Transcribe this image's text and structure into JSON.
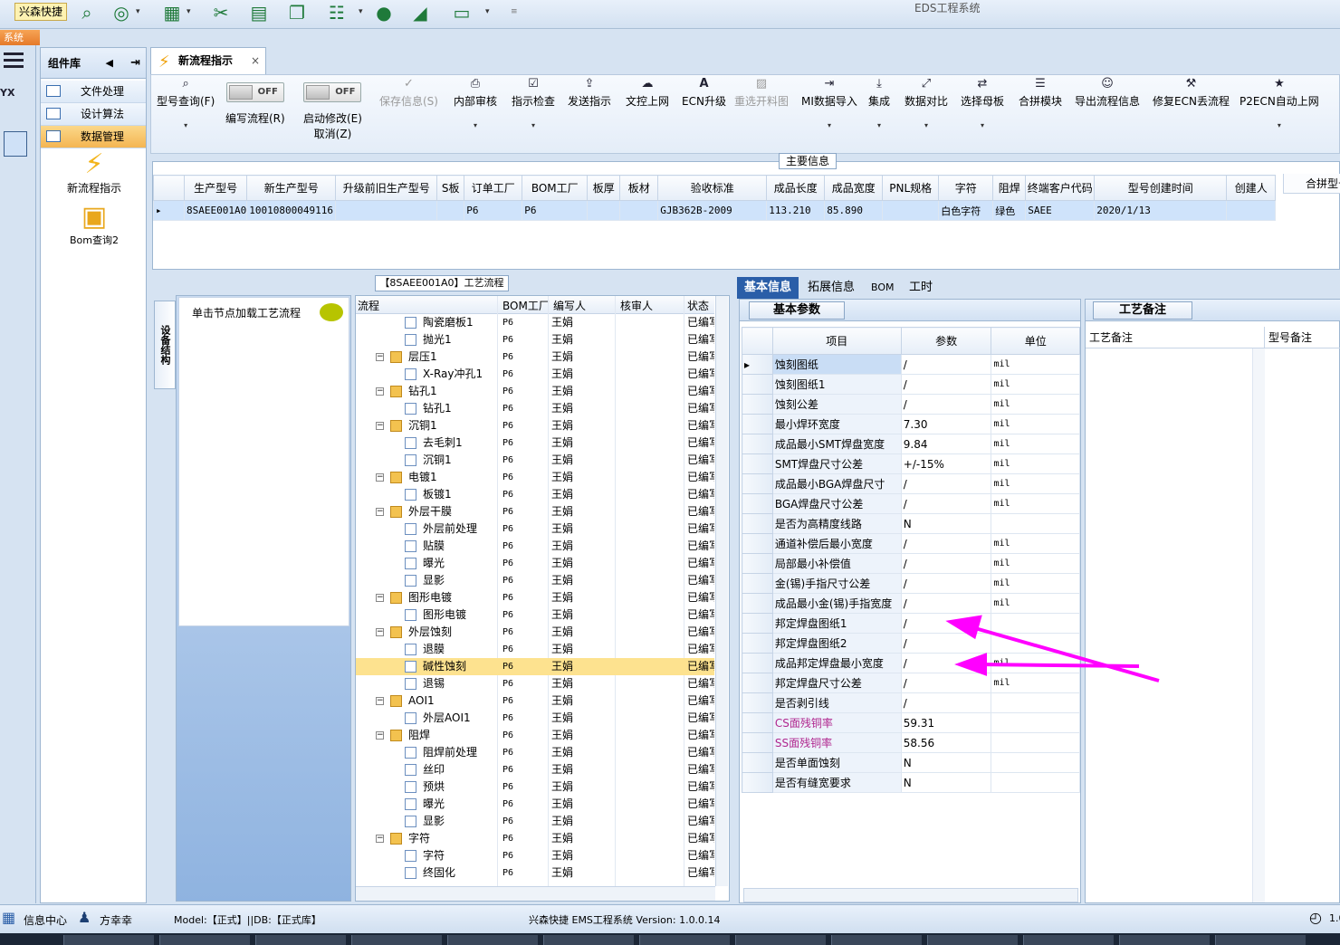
{
  "topbar": {
    "badge": "兴森快捷",
    "window_title": "EDS工程系统"
  },
  "systab": "系统",
  "component_panel": {
    "title": "组件库",
    "items": [
      "文件处理",
      "设计算法",
      "数据管理"
    ],
    "active_index": 2,
    "icons": [
      {
        "label": "新流程指示",
        "icon": "lightning-icon"
      },
      {
        "label": "Bom查询2",
        "icon": "folder-open-icon"
      }
    ]
  },
  "doc_tab": {
    "label": "新流程指示"
  },
  "toolbar": {
    "buttons": [
      {
        "label": "型号查询(F)",
        "icon": "search-icon",
        "enabled": true,
        "dropdown": true
      },
      {
        "label": "编写流程(R)",
        "toggle": "OFF"
      },
      {
        "label": "启动修改(E)",
        "label2": "取消(Z)",
        "toggle": "OFF"
      },
      {
        "label": "保存信息(S)",
        "icon": "check-icon",
        "enabled": false
      },
      {
        "label": "内部审核",
        "icon": "printer-icon",
        "enabled": true,
        "dropdown": true
      },
      {
        "label": "指示检查",
        "icon": "checkbox-icon",
        "enabled": true,
        "dropdown": true
      },
      {
        "label": "发送指示",
        "icon": "upload-icon",
        "enabled": true
      },
      {
        "label": "文控上网",
        "icon": "cloud-upload-icon",
        "enabled": true
      },
      {
        "label": "ECN升级",
        "icon": "font-icon",
        "enabled": true
      },
      {
        "label": "重选开料图",
        "icon": "image-icon",
        "enabled": false
      },
      {
        "label": "MI数据导入",
        "icon": "import-icon",
        "enabled": true,
        "dropdown": true
      },
      {
        "label": "集成",
        "icon": "download-icon",
        "enabled": true,
        "dropdown": true
      },
      {
        "label": "数据对比",
        "icon": "compare-icon",
        "enabled": true,
        "dropdown": true
      },
      {
        "label": "选择母板",
        "icon": "shuffle-icon",
        "enabled": true,
        "dropdown": true
      },
      {
        "label": "合拼模块",
        "icon": "list-icon",
        "enabled": true
      },
      {
        "label": "导出流程信息",
        "icon": "smile-icon",
        "enabled": true
      },
      {
        "label": "修复ECN丢流程",
        "icon": "wrench-icon",
        "enabled": true
      },
      {
        "label": "P2ECN自动上网",
        "icon": "star-icon",
        "enabled": true,
        "dropdown": true
      }
    ]
  },
  "main_info": {
    "title": "主要信息",
    "columns": [
      "生产型号",
      "新生产型号",
      "升级前旧生产型号",
      "S板",
      "订单工厂",
      "BOM工厂",
      "板厚",
      "板材",
      "验收标准",
      "成品长度",
      "成品宽度",
      "PNL规格",
      "字符",
      "阻焊",
      "终端客户代码",
      "型号创建时间",
      "创建人"
    ],
    "rows": [
      [
        "8SAEE001A0",
        "10010800049116",
        "",
        "",
        "P6",
        "P6",
        "",
        "",
        "GJB362B-2009",
        "113.210",
        "85.890",
        "",
        "白色字符",
        "绿色",
        "SAEE",
        "2020/1/13",
        ""
      ]
    ],
    "side_column": "合拼型号"
  },
  "process": {
    "title": "【8SAEE001A0】工艺流程",
    "equip_tab": "设备结构",
    "load_hint": "单击节点加载工艺流程",
    "columns": [
      "流程",
      "BOM工厂",
      "编写人",
      "核审人",
      "状态"
    ],
    "rows": [
      {
        "name": "陶瓷磨板1",
        "level": 2,
        "bom": "P6",
        "author": "王娟",
        "status": "已编写"
      },
      {
        "name": "抛光1",
        "level": 2,
        "bom": "P6",
        "author": "王娟",
        "status": "已编写"
      },
      {
        "name": "层压1",
        "level": 1,
        "bom": "P6",
        "author": "王娟",
        "status": "已编写"
      },
      {
        "name": "X-Ray冲孔1",
        "level": 2,
        "bom": "P6",
        "author": "王娟",
        "status": "已编写"
      },
      {
        "name": "钻孔1",
        "level": 1,
        "bom": "P6",
        "author": "王娟",
        "status": "已编写"
      },
      {
        "name": "钻孔1",
        "level": 2,
        "bom": "P6",
        "author": "王娟",
        "status": "已编写"
      },
      {
        "name": "沉铜1",
        "level": 1,
        "bom": "P6",
        "author": "王娟",
        "status": "已编写"
      },
      {
        "name": "去毛刺1",
        "level": 2,
        "bom": "P6",
        "author": "王娟",
        "status": "已编写"
      },
      {
        "name": "沉铜1",
        "level": 2,
        "bom": "P6",
        "author": "王娟",
        "status": "已编写"
      },
      {
        "name": "电镀1",
        "level": 1,
        "bom": "P6",
        "author": "王娟",
        "status": "已编写"
      },
      {
        "name": "板镀1",
        "level": 2,
        "bom": "P6",
        "author": "王娟",
        "status": "已编写"
      },
      {
        "name": "外层干膜",
        "level": 1,
        "bom": "P6",
        "author": "王娟",
        "status": "已编写"
      },
      {
        "name": "外层前处理",
        "level": 2,
        "bom": "P6",
        "author": "王娟",
        "status": "已编写"
      },
      {
        "name": "贴膜",
        "level": 2,
        "bom": "P6",
        "author": "王娟",
        "status": "已编写"
      },
      {
        "name": "曝光",
        "level": 2,
        "bom": "P6",
        "author": "王娟",
        "status": "已编写"
      },
      {
        "name": "显影",
        "level": 2,
        "bom": "P6",
        "author": "王娟",
        "status": "已编写"
      },
      {
        "name": "图形电镀",
        "level": 1,
        "bom": "P6",
        "author": "王娟",
        "status": "已编写"
      },
      {
        "name": "图形电镀",
        "level": 2,
        "bom": "P6",
        "author": "王娟",
        "status": "已编写"
      },
      {
        "name": "外层蚀刻",
        "level": 1,
        "bom": "P6",
        "author": "王娟",
        "status": "已编写"
      },
      {
        "name": "退膜",
        "level": 2,
        "bom": "P6",
        "author": "王娟",
        "status": "已编写"
      },
      {
        "name": "碱性蚀刻",
        "level": 2,
        "bom": "P6",
        "author": "王娟",
        "status": "已编写",
        "selected": true
      },
      {
        "name": "退锡",
        "level": 2,
        "bom": "P6",
        "author": "王娟",
        "status": "已编写"
      },
      {
        "name": "AOI1",
        "level": 1,
        "bom": "P6",
        "author": "王娟",
        "status": "已编写"
      },
      {
        "name": "外层AOI1",
        "level": 2,
        "bom": "P6",
        "author": "王娟",
        "status": "已编写"
      },
      {
        "name": "阻焊",
        "level": 1,
        "bom": "P6",
        "author": "王娟",
        "status": "已编写"
      },
      {
        "name": "阻焊前处理",
        "level": 2,
        "bom": "P6",
        "author": "王娟",
        "status": "已编写"
      },
      {
        "name": "丝印",
        "level": 2,
        "bom": "P6",
        "author": "王娟",
        "status": "已编写"
      },
      {
        "name": "预烘",
        "level": 2,
        "bom": "P6",
        "author": "王娟",
        "status": "已编写"
      },
      {
        "name": "曝光",
        "level": 2,
        "bom": "P6",
        "author": "王娟",
        "status": "已编写"
      },
      {
        "name": "显影",
        "level": 2,
        "bom": "P6",
        "author": "王娟",
        "status": "已编写"
      },
      {
        "name": "字符",
        "level": 1,
        "bom": "P6",
        "author": "王娟",
        "status": "已编写"
      },
      {
        "name": "字符",
        "level": 2,
        "bom": "P6",
        "author": "王娟",
        "status": "已编写"
      },
      {
        "name": "终固化",
        "level": 2,
        "bom": "P6",
        "author": "王娟",
        "status": "已编写"
      }
    ]
  },
  "right_tabs": [
    "基本信息",
    "拓展信息",
    "BOM",
    "工时"
  ],
  "basic_params": {
    "title": "基本参数",
    "columns": [
      "项目",
      "参数",
      "单位"
    ],
    "rows": [
      {
        "k": "蚀刻图纸",
        "v": "/",
        "u": "mil"
      },
      {
        "k": "蚀刻图纸1",
        "v": "/",
        "u": "mil"
      },
      {
        "k": "蚀刻公差",
        "v": "/",
        "u": "mil"
      },
      {
        "k": "最小焊环宽度",
        "v": "7.30",
        "u": "mil"
      },
      {
        "k": "成品最小SMT焊盘宽度",
        "v": "9.84",
        "u": "mil"
      },
      {
        "k": "SMT焊盘尺寸公差",
        "v": "+/-15%",
        "u": "mil"
      },
      {
        "k": "成品最小BGA焊盘尺寸",
        "v": "/",
        "u": "mil"
      },
      {
        "k": "BGA焊盘尺寸公差",
        "v": "/",
        "u": "mil"
      },
      {
        "k": "是否为高精度线路",
        "v": "N",
        "u": ""
      },
      {
        "k": "通道补偿后最小宽度",
        "v": "/",
        "u": "mil"
      },
      {
        "k": "局部最小补偿值",
        "v": "/",
        "u": "mil"
      },
      {
        "k": "金(锡)手指尺寸公差",
        "v": "/",
        "u": "mil"
      },
      {
        "k": "成品最小金(锡)手指宽度",
        "v": "/",
        "u": "mil"
      },
      {
        "k": "邦定焊盘图纸1",
        "v": "/",
        "u": ""
      },
      {
        "k": "邦定焊盘图纸2",
        "v": "/",
        "u": ""
      },
      {
        "k": "成品邦定焊盘最小宽度",
        "v": "/",
        "u": "mil"
      },
      {
        "k": "邦定焊盘尺寸公差",
        "v": "/",
        "u": "mil"
      },
      {
        "k": "是否剥引线",
        "v": "/",
        "u": ""
      },
      {
        "k": "CS面残铜率",
        "v": "59.31",
        "u": ""
      },
      {
        "k": "SS面残铜率",
        "v": "58.56",
        "u": ""
      },
      {
        "k": "是否单面蚀刻",
        "v": "N",
        "u": ""
      },
      {
        "k": "是否有缝宽要求",
        "v": "N",
        "u": ""
      }
    ]
  },
  "process_notes": {
    "title": "工艺备注",
    "columns": [
      "工艺备注",
      "型号备注"
    ]
  },
  "status_bar": {
    "info_center": "信息中心",
    "user": "方幸幸",
    "model": "Model:【正式】||DB:【正式库】",
    "version": "兴森快捷 EMS工程系统 Version: 1.0.0.14",
    "right": "1.0"
  },
  "colors": {
    "accent": "#2a5ea8",
    "selected_row": "#fde28f",
    "arrow": "#ff00ff"
  }
}
